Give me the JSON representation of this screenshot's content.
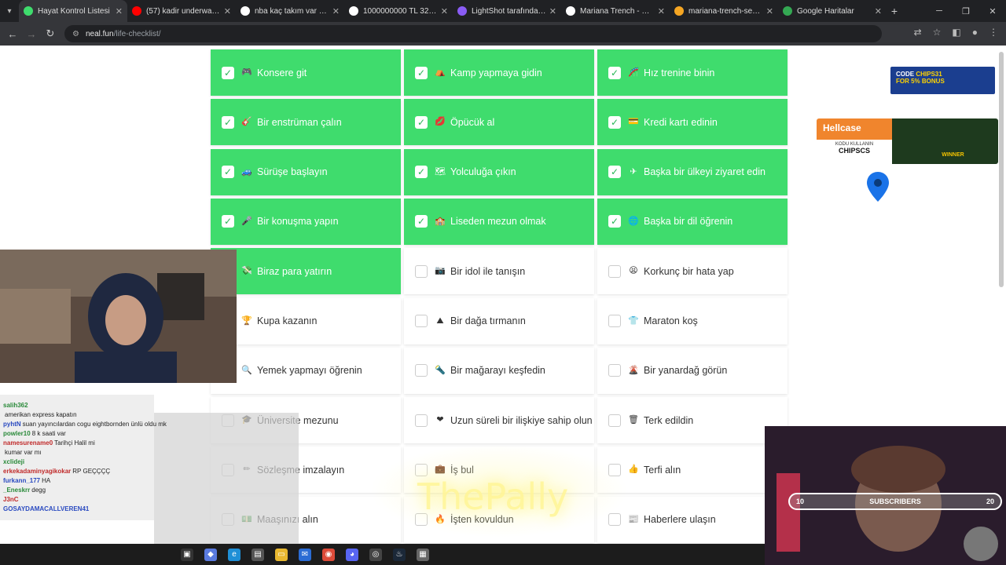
{
  "browser": {
    "tabs": [
      {
        "title": "Hayat Kontrol Listesi",
        "color": "#3fdc6d",
        "active": true
      },
      {
        "title": "(57) kadir underwater ru",
        "color": "#ff0000"
      },
      {
        "title": "nba kaç takım var - Goog",
        "color": "#ffffff"
      },
      {
        "title": "1000000000 TL 32 Gün V",
        "color": "#ffffff"
      },
      {
        "title": "LightShot tarafından Ekra",
        "color": "#8a5cf5"
      },
      {
        "title": "Mariana Trench - Google",
        "color": "#ffffff"
      },
      {
        "title": "mariana-trench-sea-illust",
        "color": "#f5a623"
      },
      {
        "title": "Google Haritalar",
        "color": "#34a853"
      }
    ],
    "url_host": "neal.fun",
    "url_path": "/life-checklist/"
  },
  "checklist": [
    {
      "label": "Konsere git",
      "emoji": "🎮",
      "done": true
    },
    {
      "label": "Kamp yapmaya gidin",
      "emoji": "⛺",
      "done": true
    },
    {
      "label": "Hız trenine binin",
      "emoji": "🎢",
      "done": true
    },
    {
      "label": "Bir enstrüman çalın",
      "emoji": "🎸",
      "done": true
    },
    {
      "label": "Öpücük al",
      "emoji": "💋",
      "done": true
    },
    {
      "label": "Kredi kartı edinin",
      "emoji": "💳",
      "done": true
    },
    {
      "label": "Sürüşe başlayın",
      "emoji": "🚙",
      "done": true
    },
    {
      "label": "Yolculuğa çıkın",
      "emoji": "🗺",
      "done": true
    },
    {
      "label": "Başka bir ülkeyi ziyaret edin",
      "emoji": "✈",
      "done": true
    },
    {
      "label": "Bir konuşma yapın",
      "emoji": "🎤",
      "done": true
    },
    {
      "label": "Liseden mezun olmak",
      "emoji": "🏫",
      "done": true
    },
    {
      "label": "Başka bir dil öğrenin",
      "emoji": "🌐",
      "done": true
    },
    {
      "label": "Biraz para yatırın",
      "emoji": "💸",
      "done": true
    },
    {
      "label": "Bir idol ile tanışın",
      "emoji": "📷",
      "done": false
    },
    {
      "label": "Korkunç bir hata yap",
      "emoji": "😫",
      "done": false
    },
    {
      "label": "Kupa kazanın",
      "emoji": "🏆",
      "done": false
    },
    {
      "label": "Bir dağa tırmanın",
      "emoji": "⛰",
      "done": false
    },
    {
      "label": "Maraton koş",
      "emoji": "👕",
      "done": false
    },
    {
      "label": "Yemek yapmayı öğrenin",
      "emoji": "🔍",
      "done": false
    },
    {
      "label": "Bir mağarayı keşfedin",
      "emoji": "🔦",
      "done": false
    },
    {
      "label": "Bir yanardağ görün",
      "emoji": "🌋",
      "done": false
    },
    {
      "label": "Üniversite mezunu",
      "emoji": "🎓",
      "done": false
    },
    {
      "label": "Uzun süreli bir ilişkiye sahip olun",
      "emoji": "❤",
      "done": false
    },
    {
      "label": "Terk edildin",
      "emoji": "🗑",
      "done": false
    },
    {
      "label": "Sözleşme imzalayın",
      "emoji": "✏",
      "done": false
    },
    {
      "label": "İş bul",
      "emoji": "💼",
      "done": false
    },
    {
      "label": "Terfi alın",
      "emoji": "👍",
      "done": false
    },
    {
      "label": "Maaşınızı alın",
      "emoji": "💵",
      "done": false
    },
    {
      "label": "İşten kovuldun",
      "emoji": "🔥",
      "done": false
    },
    {
      "label": "Haberlere ulaşın",
      "emoji": "📰",
      "done": false
    }
  ],
  "ads": {
    "chips_code": "CODE",
    "chips_value": "CHIPS31",
    "chips_bonus": "FOR 5% BONUS",
    "hellcase": "Hellcase",
    "hellcase_sub": "KODU KULLANIN",
    "hellcase_code": "CHIPSCS",
    "winner": "WINNER"
  },
  "stream": {
    "subs_min": "10",
    "subs_label": "SUBSCRIBERS",
    "subs_max": "20",
    "watermark": "ThePally"
  },
  "chat": [
    {
      "name": "salih362",
      "text": ""
    },
    {
      "name": "",
      "text": "amerikan express kapatın"
    },
    {
      "name": "pyhtN",
      "text": "suan yayıncılardan cogu eightbornden ünlü oldu mk"
    },
    {
      "name": "powler10",
      "text": "8 k saati var"
    },
    {
      "name": "namesurename0",
      "text": "Tarihçi Halil mi"
    },
    {
      "name": "",
      "text": "kumar var mı"
    },
    {
      "name": "xclideji",
      "text": ""
    },
    {
      "name": "erkekadaminyagikokar",
      "text": "RP GEÇÇÇÇ"
    },
    {
      "name": "furkann_177",
      "text": "HA"
    },
    {
      "name": "_Eneskrr",
      "text": "degg"
    },
    {
      "name": "J3nC",
      "text": ""
    },
    {
      "name": "GOSAYDAMACALLVEREN41",
      "text": ""
    }
  ]
}
